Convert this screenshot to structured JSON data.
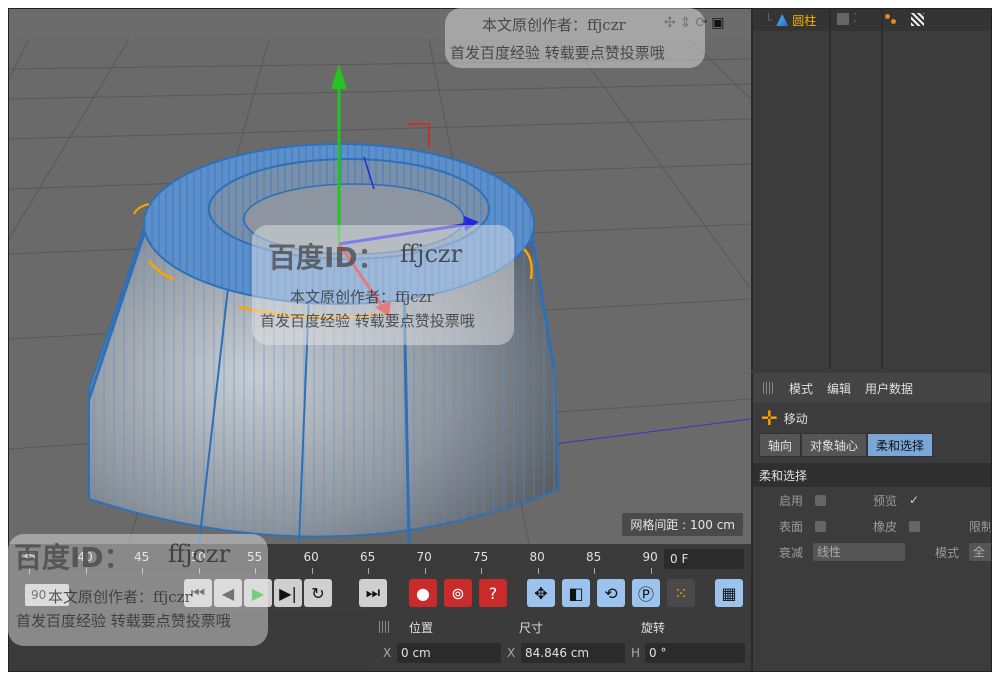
{
  "object_manager": {
    "object_name": "圆柱"
  },
  "attributes": {
    "menu": [
      "模式",
      "编辑",
      "用户数据"
    ],
    "tool_name": "移动",
    "tabs": [
      "轴向",
      "对象轴心",
      "柔和选择"
    ],
    "active_tab": "柔和选择",
    "section_title": "柔和选择",
    "enable_label": "启用",
    "preview_label": "预览",
    "preview_check": "✓",
    "surface_label": "表面",
    "rubber_label": "橡皮",
    "limit_label": "限制",
    "falloff_label": "衰减",
    "falloff_value": "线性",
    "mode_label": "模式",
    "mode_value": "全"
  },
  "viewport": {
    "grid_spacing": "网格间距 : 100 cm"
  },
  "timeline": {
    "ticks": [
      "35",
      "40",
      "45",
      "50",
      "55",
      "60",
      "65",
      "70",
      "75",
      "80",
      "85",
      "90"
    ],
    "current_frame": "0 F",
    "start_field": "90"
  },
  "coordinates": {
    "headers": [
      "位置",
      "尺寸",
      "旋转"
    ],
    "x_label": "X",
    "x_position": "0 cm",
    "x_size_label": "X",
    "x_size": "84.846 cm",
    "h_label": "H",
    "h_rotation": "0 °"
  },
  "watermark": {
    "id_text": "百度ID：",
    "id_name": "ffjczr",
    "author_line": "本文原创作者：ffjczr",
    "share_line": "首发百度经验 转载要点赞投票哦"
  },
  "colors": {
    "accent_orange": "#ffa200",
    "active_tab": "#7aa7d8",
    "mesh_blue": "#4a8fd6",
    "axis_green": "#22c322",
    "axis_red": "#e02020",
    "axis_blue": "#2525e0"
  }
}
